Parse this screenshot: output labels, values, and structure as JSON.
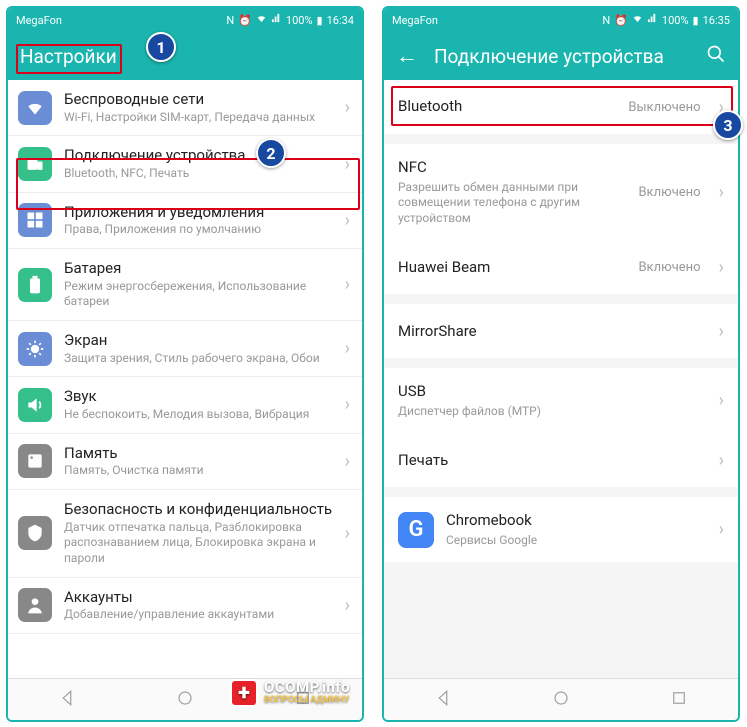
{
  "left": {
    "statusbar": {
      "carrier": "MegaFon",
      "battery": "100%",
      "time": "16:34"
    },
    "title": "Настройки",
    "items": [
      {
        "id": "wireless",
        "icon": "wifi-icon",
        "color": "#6a8dd6",
        "title": "Беспроводные сети",
        "sub": "Wi-Fi, Настройки SIM-карт, Передача данных"
      },
      {
        "id": "connections",
        "icon": "devices-icon",
        "color": "#35c08b",
        "title": "Подключение устройства",
        "sub": "Bluetooth, NFC, Печать"
      },
      {
        "id": "apps",
        "icon": "apps-icon",
        "color": "#6a8dd6",
        "title": "Приложения и уведомления",
        "sub": "Права, Приложения по умолчанию"
      },
      {
        "id": "battery",
        "icon": "battery-icon",
        "color": "#35c08b",
        "title": "Батарея",
        "sub": "Режим энергосбережения, Использование батареи"
      },
      {
        "id": "display",
        "icon": "display-icon",
        "color": "#6a8dd6",
        "title": "Экран",
        "sub": "Защита зрения, Стиль рабочего экрана, Обои"
      },
      {
        "id": "sound",
        "icon": "sound-icon",
        "color": "#35c08b",
        "title": "Звук",
        "sub": "Не беспокоить, Мелодия вызова, Вибрация"
      },
      {
        "id": "storage",
        "icon": "storage-icon",
        "color": "#888",
        "title": "Память",
        "sub": "Память, Очистка памяти"
      },
      {
        "id": "security",
        "icon": "security-icon",
        "color": "#888",
        "title": "Безопасность и конфиденциальность",
        "sub": "Датчик отпечатка пальца, Разблокировка распознаванием лица, Блокировка экрана и пароли"
      },
      {
        "id": "accounts",
        "icon": "accounts-icon",
        "color": "#888",
        "title": "Аккаунты",
        "sub": "Добавление/управление аккаунтами"
      }
    ]
  },
  "right": {
    "statusbar": {
      "carrier": "MegaFon",
      "battery": "100%",
      "time": "16:35"
    },
    "title": "Подключение устройства",
    "items": [
      {
        "id": "bluetooth",
        "title": "Bluetooth",
        "value": "Выключено"
      },
      {
        "id": "nfc",
        "title": "NFC",
        "sub": "Разрешить обмен данными при совмещении телефона с другим устройством",
        "value": "Включено"
      },
      {
        "id": "huawei-beam",
        "title": "Huawei Beam",
        "value": "Включено"
      },
      {
        "id": "mirrorshare",
        "title": "MirrorShare"
      },
      {
        "id": "usb",
        "title": "USB",
        "sub": "Диспетчер файлов (MTP)"
      },
      {
        "id": "print",
        "title": "Печать"
      },
      {
        "id": "chromebook",
        "title": "Chromebook",
        "sub": "Сервисы Google",
        "icon": "chrome"
      }
    ]
  },
  "badges": {
    "b1": "1",
    "b2": "2",
    "b3": "3"
  },
  "watermark": {
    "line1": "OCOMP.info",
    "line2": "ВОПРОСЫ АДМИНУ"
  }
}
